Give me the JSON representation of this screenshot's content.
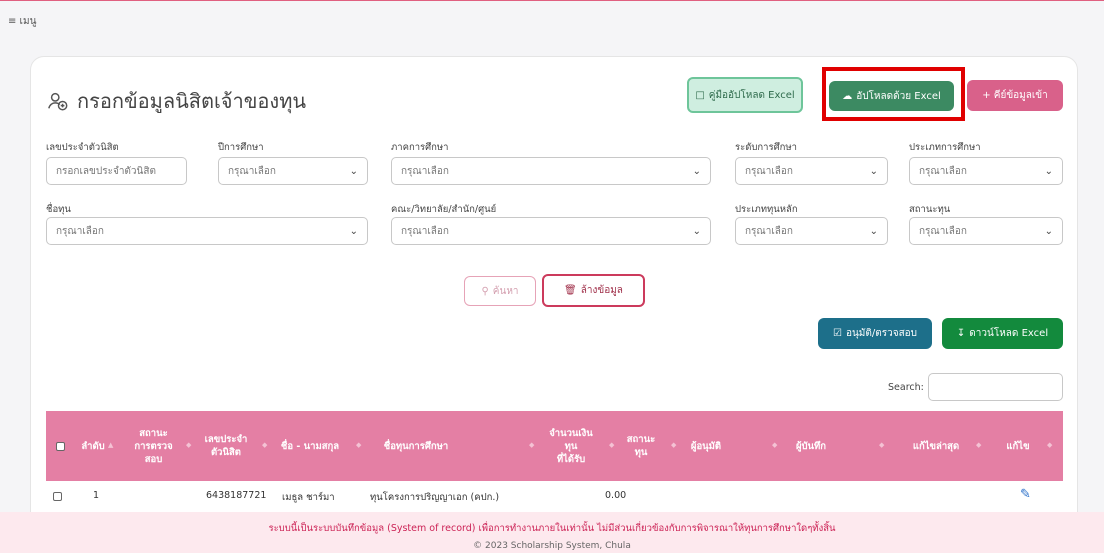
{
  "menu": {
    "label": "≡ เมนู"
  },
  "page": {
    "title": "กรอกข้อมูลนิสิตเจ้าของทุน"
  },
  "buttons": {
    "guide": "คู่มืออัปโหลด Excel",
    "upload": "อัปโหลดด้วย Excel",
    "add": "+ คีย์ข้อมูลเข้า",
    "search": "ค้นหา",
    "clear": "ล้างข้อมูล",
    "approve": "อนุมัติ/ตรวจสอบ",
    "download": "ดาวน์โหลด Excel"
  },
  "filters": {
    "student_id": {
      "label": "เลขประจำตัวนิสิต",
      "placeholder": "กรอกเลขประจำตัวนิสิต"
    },
    "year": {
      "label": "ปีการศึกษา",
      "value": "กรุณาเลือก"
    },
    "semester": {
      "label": "ภาคการศึกษา",
      "value": "กรุณาเลือก"
    },
    "level": {
      "label": "ระดับการศึกษา",
      "value": "กรุณาเลือก"
    },
    "study_type": {
      "label": "ประเภทการศึกษา",
      "value": "กรุณาเลือก"
    },
    "fund_name": {
      "label": "ชื่อทุน",
      "value": "กรุณาเลือก"
    },
    "faculty": {
      "label": "คณะ/วิทยาลัย/สำนัก/ศูนย์",
      "value": "กรุณาเลือก"
    },
    "fund_type": {
      "label": "ประเภททุนหลัก",
      "value": "กรุณาเลือก"
    },
    "fund_status": {
      "label": "สถานะทุน",
      "value": "กรุณาเลือก"
    }
  },
  "table": {
    "search_label": "Search:",
    "headers": [
      "ลำดับ",
      "สถานะ\nการตรวจ\nสอบ",
      "เลขประจำ\nตัวนิสิต",
      "ชื่อ - นามสกุล",
      "ชื่อทุนการศึกษา",
      "จำนวนเงิน\nทุน\nที่ได้รับ",
      "สถานะ\nทุน",
      "ผู้อนุมัติ",
      "ผู้บันทึก",
      "แก้ไขล่าสุด",
      "แก้ไข"
    ],
    "rows": [
      {
        "no": "1",
        "student_id": "6438187721",
        "name": "เมธูล ชาร์มา",
        "fund": "ทุนโครงการปริญญาเอก (คปก.)",
        "amount": "0.00"
      }
    ]
  },
  "footer": {
    "notice": "ระบบนี้เป็นระบบบันทึกข้อมูล (System of record) เพื่อการทำงานภายในเท่านั้น ไม่มีส่วนเกี่ยวข้องกับการพิจารณาให้ทุนการศึกษาใดๆทั้งสิ้น",
    "copyright": "© 2023 Scholarship System, Chula"
  },
  "colors": {
    "accent_pink": "#e47fa4",
    "upload_green": "#3c8a62",
    "download_green": "#138a3d",
    "approve_teal": "#1d6f8a",
    "highlight_red": "#e00000"
  },
  "icons": [
    "user-add-icon",
    "document-icon",
    "cloud-upload-icon",
    "search-icon",
    "trash-icon",
    "checklist-icon",
    "download-file-icon",
    "edit-icon"
  ]
}
